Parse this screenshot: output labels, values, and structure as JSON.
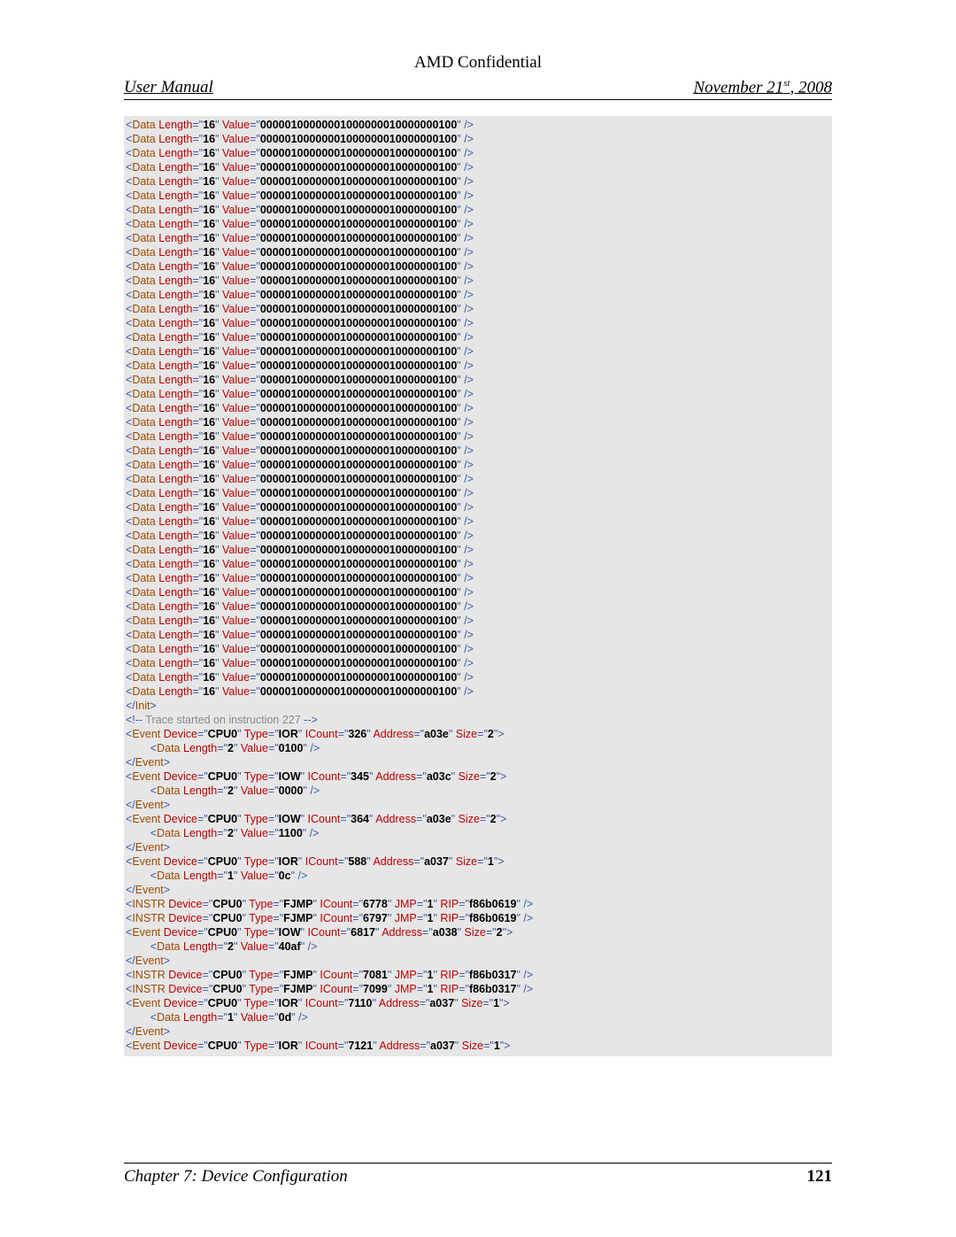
{
  "header": {
    "confidential": "AMD Confidential",
    "left": "User Manual",
    "right_prefix": "November 21",
    "right_sup": "st",
    "right_suffix": ", 2008"
  },
  "data_lines": {
    "count": 41,
    "length": "16",
    "value": "00000100000001000000010000000100"
  },
  "init_close": "</Init>",
  "comment": "<!-- Trace started on instruction 227 -->",
  "events": [
    {
      "kind": "event",
      "device": "CPU0",
      "type": "IOR",
      "icount": "326",
      "address": "a03e",
      "size": "2",
      "data_len": "2",
      "data_val": "0100"
    },
    {
      "kind": "event",
      "device": "CPU0",
      "type": "IOW",
      "icount": "345",
      "address": "a03c",
      "size": "2",
      "data_len": "2",
      "data_val": "0000"
    },
    {
      "kind": "event",
      "device": "CPU0",
      "type": "IOW",
      "icount": "364",
      "address": "a03e",
      "size": "2",
      "data_len": "2",
      "data_val": "1100"
    },
    {
      "kind": "event",
      "device": "CPU0",
      "type": "IOR",
      "icount": "588",
      "address": "a037",
      "size": "1",
      "data_len": "1",
      "data_val": "0c"
    },
    {
      "kind": "instr",
      "device": "CPU0",
      "type": "FJMP",
      "icount": "6778",
      "jmp": "1",
      "rip": "f86b0619"
    },
    {
      "kind": "instr",
      "device": "CPU0",
      "type": "FJMP",
      "icount": "6797",
      "jmp": "1",
      "rip": "f86b0619"
    },
    {
      "kind": "event",
      "device": "CPU0",
      "type": "IOW",
      "icount": "6817",
      "address": "a038",
      "size": "2",
      "data_len": "2",
      "data_val": "40af"
    },
    {
      "kind": "instr",
      "device": "CPU0",
      "type": "FJMP",
      "icount": "7081",
      "jmp": "1",
      "rip": "f86b0317"
    },
    {
      "kind": "instr",
      "device": "CPU0",
      "type": "FJMP",
      "icount": "7099",
      "jmp": "1",
      "rip": "f86b0317"
    },
    {
      "kind": "event",
      "device": "CPU0",
      "type": "IOR",
      "icount": "7110",
      "address": "a037",
      "size": "1",
      "data_len": "1",
      "data_val": "0d"
    },
    {
      "kind": "event_open",
      "device": "CPU0",
      "type": "IOR",
      "icount": "7121",
      "address": "a037",
      "size": "1"
    }
  ],
  "footer": {
    "left": "Chapter 7: Device Configuration",
    "page": "121"
  }
}
